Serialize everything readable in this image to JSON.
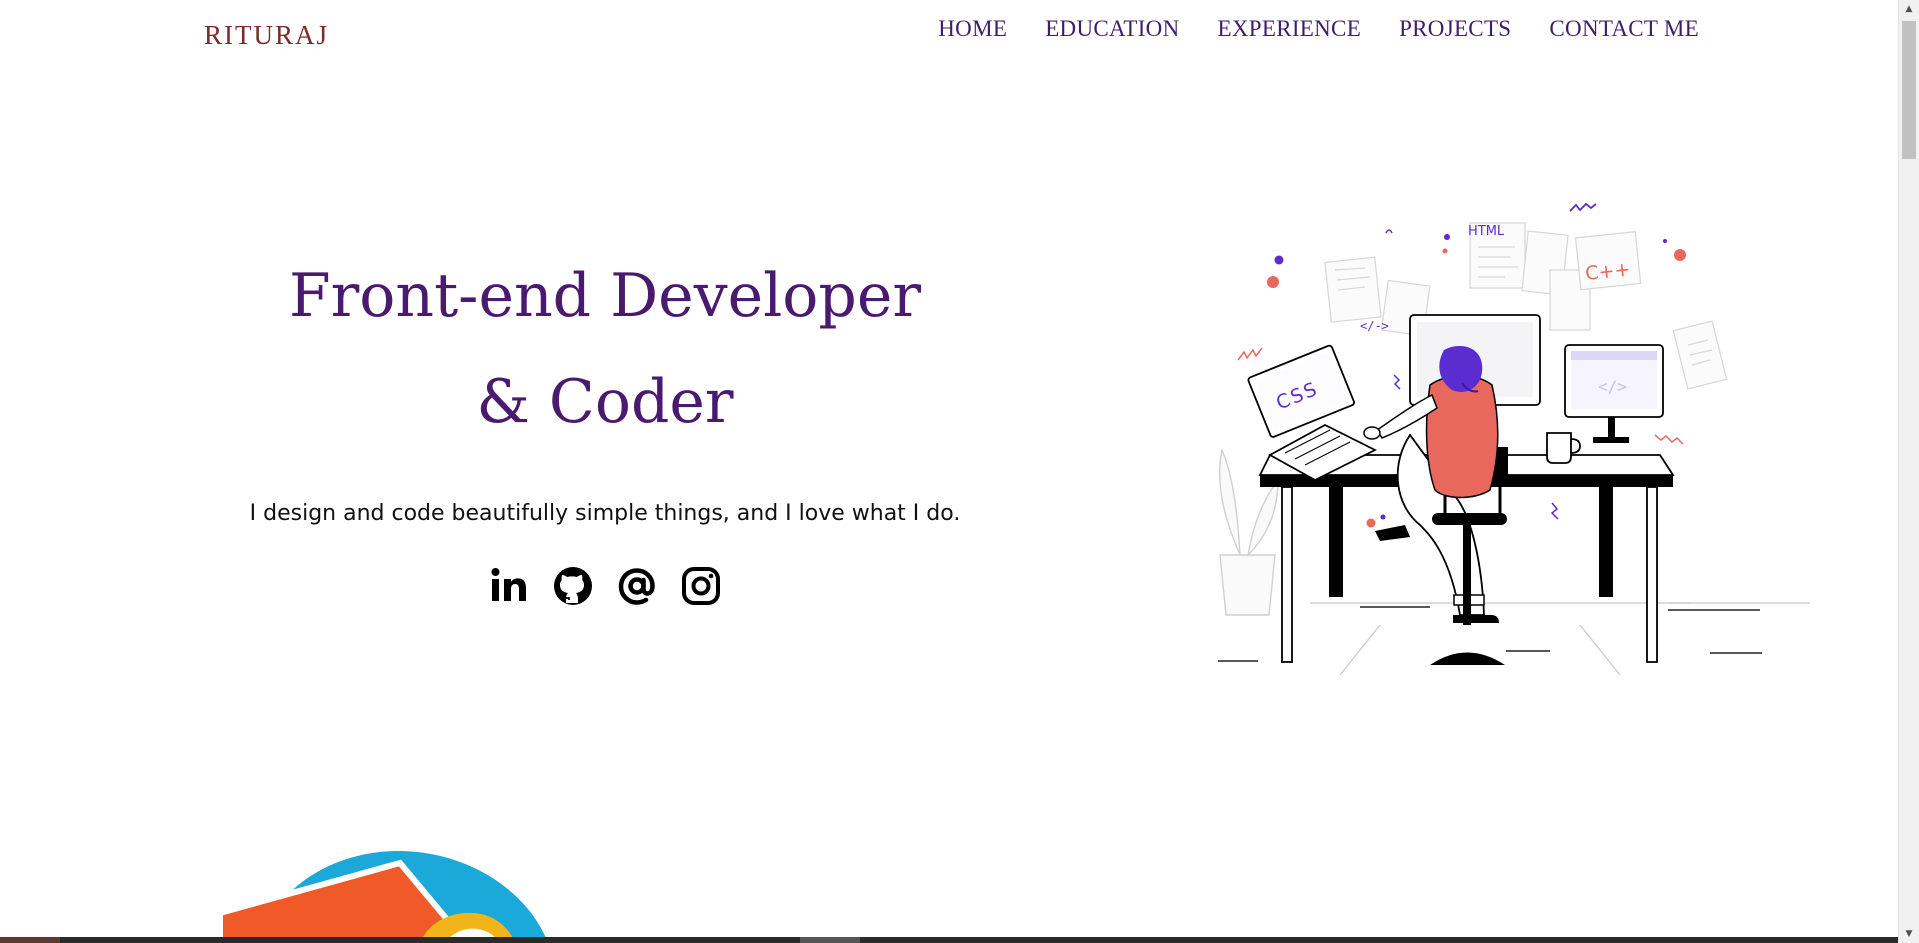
{
  "brand": {
    "logo_text": "RITURAJ"
  },
  "nav": {
    "items": [
      {
        "label": "HOME"
      },
      {
        "label": "EDUCATION"
      },
      {
        "label": "EXPERIENCE"
      },
      {
        "label": "PROJECTS"
      },
      {
        "label": "CONTACT ME"
      }
    ]
  },
  "hero": {
    "title_line1": "Front-end Developer",
    "title_line2": "& Coder",
    "tagline": "I design and code beautifully simple things, and I love what I do.",
    "socials": [
      {
        "icon": "linkedin-icon"
      },
      {
        "icon": "github-icon"
      },
      {
        "icon": "email-at-icon"
      },
      {
        "icon": "instagram-icon"
      }
    ]
  },
  "illustration": {
    "labels": {
      "css": "CSS",
      "html": "HTML",
      "cpp": "C++",
      "code_tag": "</->"
    }
  },
  "colors": {
    "title_purple": "#4a1a6f",
    "nav_purple": "#3d1e6d",
    "logo_red": "#7b2a2a",
    "accent_coral": "#e8685e",
    "accent_violet": "#5b2ccf"
  }
}
